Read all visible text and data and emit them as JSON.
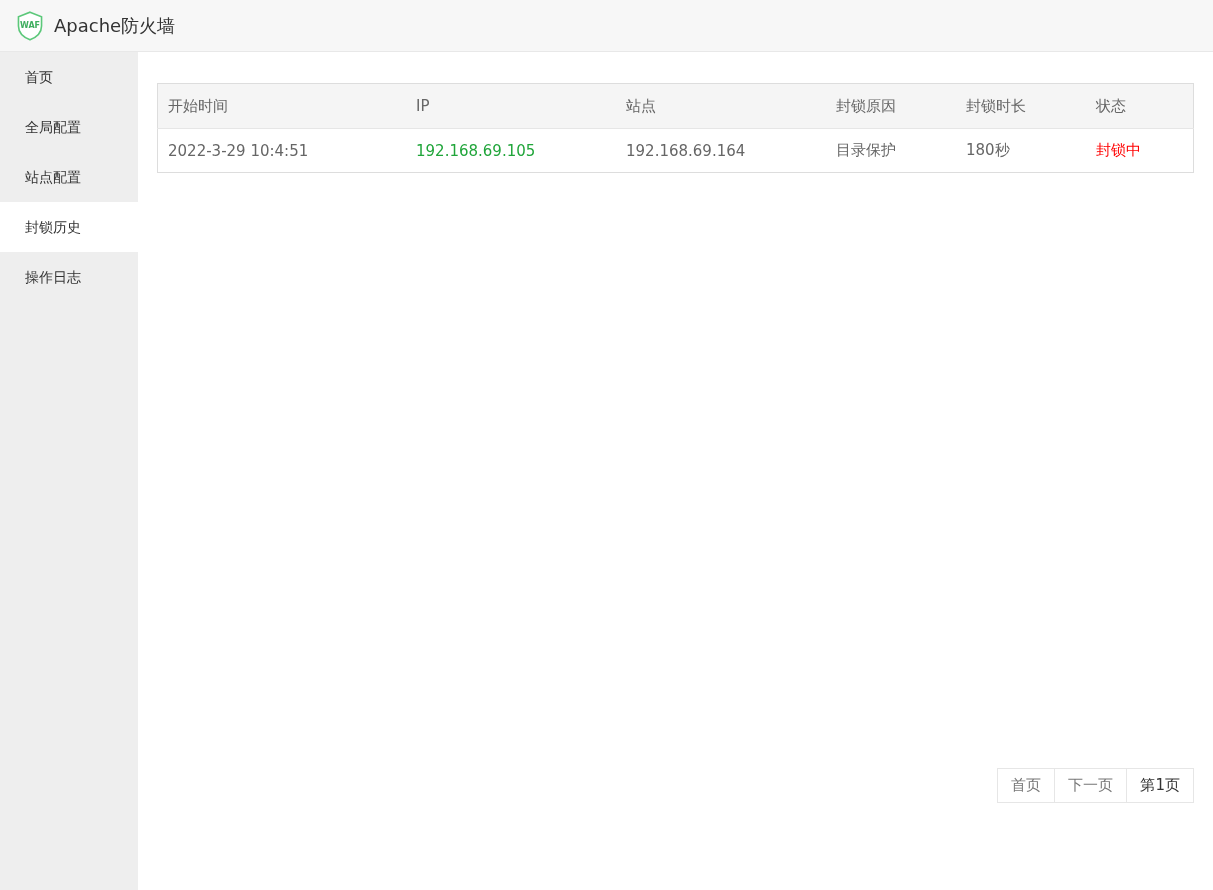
{
  "header": {
    "logo": "WAF",
    "title": "Apache防火墙"
  },
  "sidebar": {
    "items": [
      {
        "label": "首页",
        "selected": false
      },
      {
        "label": "全局配置",
        "selected": false
      },
      {
        "label": "站点配置",
        "selected": false
      },
      {
        "label": "封锁历史",
        "selected": true
      },
      {
        "label": "操作日志",
        "selected": false
      }
    ]
  },
  "table": {
    "columns": [
      "开始时间",
      "IP",
      "站点",
      "封锁原因",
      "封锁时长",
      "状态"
    ],
    "rows": [
      {
        "cells": [
          {
            "text": "2022-3-29 10:4:51",
            "color": "#666666"
          },
          {
            "text": "192.168.69.105",
            "color": "#20a53a"
          },
          {
            "text": "192.168.69.164",
            "color": "#666666"
          },
          {
            "text": "目录保护",
            "color": "#666666"
          },
          {
            "text": "180秒",
            "color": "#666666"
          },
          {
            "text": "封锁中",
            "color": "#ff0000"
          }
        ]
      }
    ]
  },
  "pagination": [
    {
      "label": "首页",
      "selected": false
    },
    {
      "label": "下一页",
      "selected": false
    },
    {
      "label": "第1页",
      "selected": true
    }
  ]
}
